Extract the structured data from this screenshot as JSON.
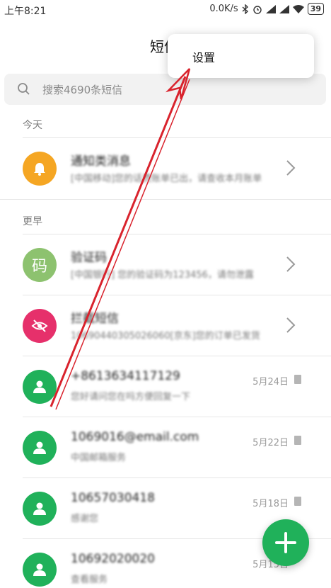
{
  "status_bar": {
    "time": "上午8:21",
    "network_speed": "0.0K/s",
    "battery": "39"
  },
  "header": {
    "title": "短信"
  },
  "search": {
    "placeholder": "搜索4690条短信"
  },
  "menu": {
    "items": [
      {
        "label": "设置"
      }
    ]
  },
  "sections": [
    {
      "label": "今天"
    },
    {
      "label": "更早"
    }
  ],
  "conversations": [
    {
      "name": "通知类消息",
      "preview": "[中国移动]您的话费账单已出，请查收本月账单信息",
      "avatar_icon": "bell-icon",
      "avatar_color": "#f5a623",
      "has_chevron": true
    },
    {
      "name": "验证码",
      "preview": "[中国银行] 您的验证码为123456，请勿泄露",
      "avatar_char": "码",
      "avatar_color": "#8dc26f",
      "has_chevron": true
    },
    {
      "name": "拦截短信",
      "preview": "10690440305026060[京东]您的订单已发货",
      "avatar_icon": "eye-off-icon",
      "avatar_color": "#e6306b",
      "has_chevron": true
    },
    {
      "name": "+8613634117129",
      "preview": "您好请问您在吗方便回复一下",
      "avatar_icon": "person-icon",
      "avatar_color": "#20b15a",
      "date": "5月24日"
    },
    {
      "name": "1069016@email.com",
      "preview": "中国邮箱服务",
      "avatar_icon": "person-icon",
      "avatar_color": "#20b15a",
      "date": "5月22日"
    },
    {
      "name": "10657030418",
      "preview": "感谢您",
      "avatar_icon": "person-icon",
      "avatar_color": "#20b15a",
      "date": "5月18日"
    },
    {
      "name": "10692020020",
      "preview": "查看服务",
      "avatar_icon": "person-icon",
      "avatar_color": "#20b15a",
      "date": "5月15日"
    }
  ],
  "fab": {
    "icon": "plus-icon"
  },
  "colors": {
    "accent": "#20b15a",
    "annotation": "#d9232d"
  }
}
